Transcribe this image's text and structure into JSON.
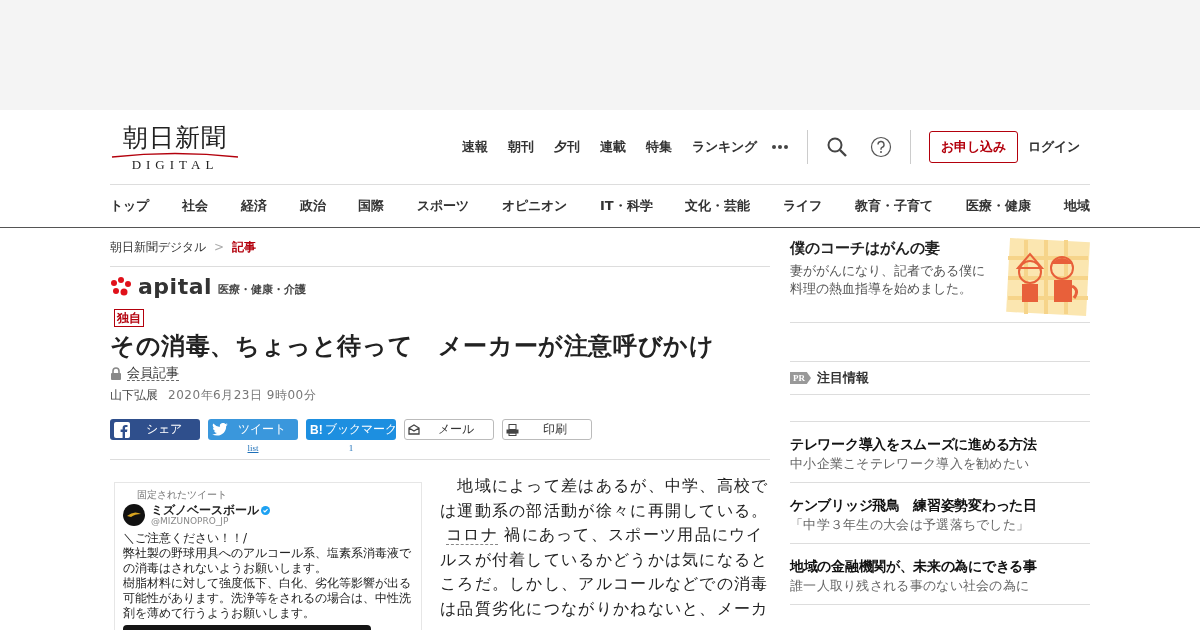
{
  "logo": {
    "title": "朝日新聞",
    "subtitle": "DIGITAL"
  },
  "top_nav": [
    "速報",
    "朝刊",
    "夕刊",
    "連載",
    "特集",
    "ランキング"
  ],
  "subscribe_button": "お申し込み",
  "login_link": "ログイン",
  "categories": [
    "トップ",
    "社会",
    "経済",
    "政治",
    "国際",
    "スポーツ",
    "オピニオン",
    "IT・科学",
    "文化・芸能",
    "ライフ",
    "教育・子育て",
    "医療・健康",
    "地域"
  ],
  "breadcrumb": [
    {
      "label": "朝日新聞デジタル",
      "selected": false
    },
    {
      "label": "記事",
      "selected": true
    }
  ],
  "breadcrumb_separator": ">",
  "section": {
    "brand": "apital",
    "tagline": "医療・健康・介護"
  },
  "badge": "独自",
  "headline": "その消毒、ちょっと待って　メーカーが注意呼びかけ",
  "member_label": "会員記事",
  "author": "山下弘展",
  "date": "2020年6月23日 9時00分",
  "share_buttons": [
    {
      "kind": "facebook",
      "label": "シェア"
    },
    {
      "kind": "twitter",
      "label": "ツイート",
      "count": "list"
    },
    {
      "kind": "hatena",
      "icon_text": "B!",
      "label": "ブックマーク",
      "count": "1"
    },
    {
      "kind": "mail",
      "label": "メール"
    },
    {
      "kind": "print",
      "label": "印刷"
    }
  ],
  "embedded_tweet": {
    "pinned_label": "固定されたツイート",
    "account_name": "ミズノベースボール",
    "handle": "@MIZUNOPRO_JP",
    "lines": [
      "＼ご注意ください！！/",
      "弊社製の野球用具へのアルコール系、塩素系消毒液で",
      "の消毒はされないようお願いします。",
      "樹脂材料に対して強度低下、白化、劣化等影響が出る",
      "可能性があります。洗浄等をされるの場合は、中性洗",
      "剤を薄めて行うようお願いします。"
    ]
  },
  "body_lines": [
    [
      {
        "text": "　地域によって差はあるが、中学、高校で"
      }
    ],
    [
      {
        "text": "は運動系の部活動が徐々に再開している。"
      }
    ],
    [
      {
        "text": "コロナ",
        "kind": "link"
      },
      {
        "text": " 禍にあって、スポーツ用品にウイ"
      }
    ],
    [
      {
        "text": "ルスが付着しているかどうかは気になると"
      }
    ],
    [
      {
        "text": "ころだ。しかし、アルコールなどでの消毒"
      }
    ],
    [
      {
        "text": "は品質劣化につながりかねないと、メーカ"
      }
    ]
  ],
  "sidebar": {
    "feature": {
      "title": "僕のコーチはがんの妻",
      "lines": [
        "妻ががんになり、記者である僕に",
        "料理の熱血指導を始めました。"
      ]
    },
    "pr_label": "PR",
    "pr_title": "注目情報",
    "promos": [
      {
        "title": "テレワーク導入をスムーズに進める方法",
        "subtitle": "中小企業こそテレワーク導入を勧めたい"
      },
      {
        "title": "ケンブリッジ飛鳥　練習姿勢変わった日",
        "subtitle": "「中学３年生の大会は予選落ちでした」"
      },
      {
        "title": "地域の金融機関が、未来の為にできる事",
        "subtitle": "誰一人取り残される事のない社会の為に"
      }
    ]
  }
}
